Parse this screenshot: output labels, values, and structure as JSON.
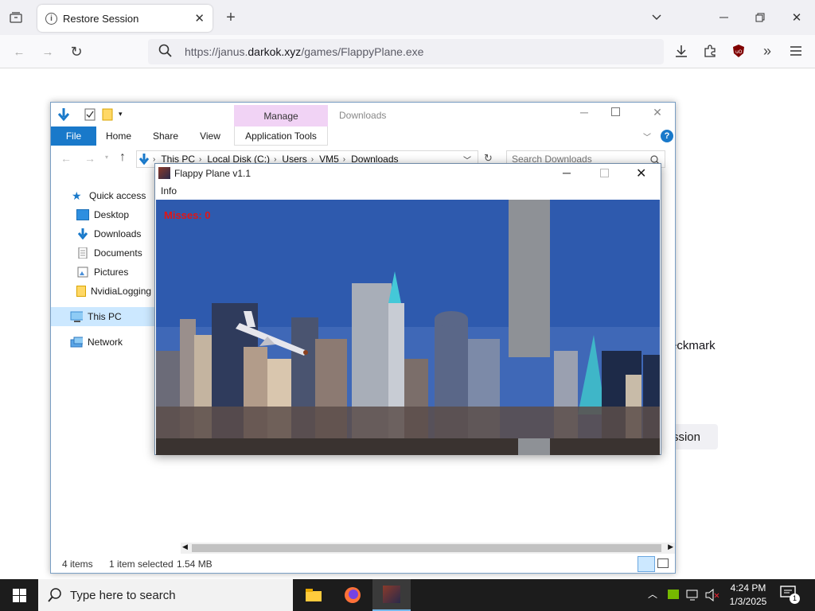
{
  "browser": {
    "tab_title": "Restore Session",
    "url_prefix": "https://janus.",
    "url_domain": "darkok.xyz",
    "url_path": "/games/FlappyPlane.exe",
    "page_text_fragment": "eckmark",
    "page_button_fragment": "ssion"
  },
  "explorer": {
    "title": "Downloads",
    "manage_tab": "Manage",
    "ribbon_tabs": [
      "File",
      "Home",
      "Share",
      "View",
      "Application Tools"
    ],
    "breadcrumb": [
      "This PC",
      "Local Disk (C:)",
      "Users",
      "VM5",
      "Downloads"
    ],
    "search_placeholder": "Search Downloads",
    "nav": [
      {
        "label": "Quick access",
        "icon": "star-icon"
      },
      {
        "label": "Desktop",
        "icon": "desktop-icon"
      },
      {
        "label": "Downloads",
        "icon": "download-arrow-icon"
      },
      {
        "label": "Documents",
        "icon": "document-icon"
      },
      {
        "label": "Pictures",
        "icon": "pictures-icon"
      },
      {
        "label": "NvidiaLogging",
        "icon": "folder-icon"
      },
      {
        "label": "This PC",
        "icon": "computer-icon"
      },
      {
        "label": "Network",
        "icon": "network-icon"
      }
    ],
    "status": {
      "items": "4 items",
      "selected": "1 item selected",
      "size": "1.54 MB"
    }
  },
  "game": {
    "title": "Flappy Plane v1.1",
    "menu_info": "Info",
    "misses": "Misses: 0"
  },
  "taskbar": {
    "search_placeholder": "Type here to search",
    "time": "4:24 PM",
    "date": "1/3/2025",
    "notification_count": "1"
  },
  "colors": {
    "sky": "#2e5aae",
    "file_tab": "#1979ca",
    "manage_tab": "#f1d3f5",
    "misses_text": "#e21515",
    "taskbar": "#1c1c1c"
  }
}
